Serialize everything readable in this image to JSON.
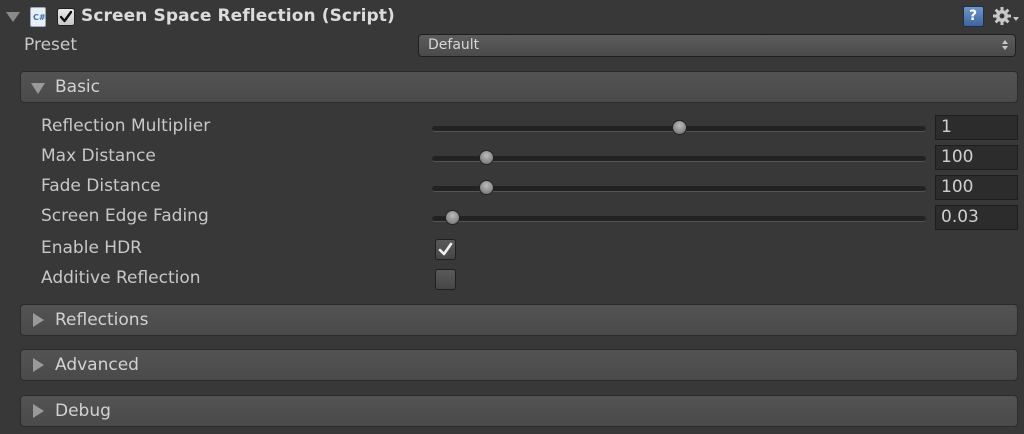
{
  "component": {
    "title": "Screen Space Reflection (Script)",
    "script_icon_text": "C#",
    "help_glyph": "?",
    "enabled": true,
    "expanded": true
  },
  "preset": {
    "label": "Preset",
    "value": "Default"
  },
  "sections": [
    {
      "label": "Basic",
      "expanded": true,
      "fields": [
        {
          "label": "Reflection Multiplier",
          "type": "slider",
          "value": "1",
          "slider_fraction": 0.5
        },
        {
          "label": "Max Distance",
          "type": "slider",
          "value": "100",
          "slider_fraction": 0.11
        },
        {
          "label": "Fade Distance",
          "type": "slider",
          "value": "100",
          "slider_fraction": 0.11
        },
        {
          "label": "Screen Edge Fading",
          "type": "slider",
          "value": "0.03",
          "slider_fraction": 0.04
        },
        {
          "label": "Enable HDR",
          "type": "toggle",
          "checked": true
        },
        {
          "label": "Additive Reflection",
          "type": "toggle",
          "checked": false
        }
      ]
    },
    {
      "label": "Reflections",
      "expanded": false
    },
    {
      "label": "Advanced",
      "expanded": false
    },
    {
      "label": "Debug",
      "expanded": false
    }
  ],
  "colors": {
    "background": "#383838",
    "text": "#c8c8c8",
    "section_bg": "#4e4e4e",
    "field_bg": "#2c2c2c"
  }
}
